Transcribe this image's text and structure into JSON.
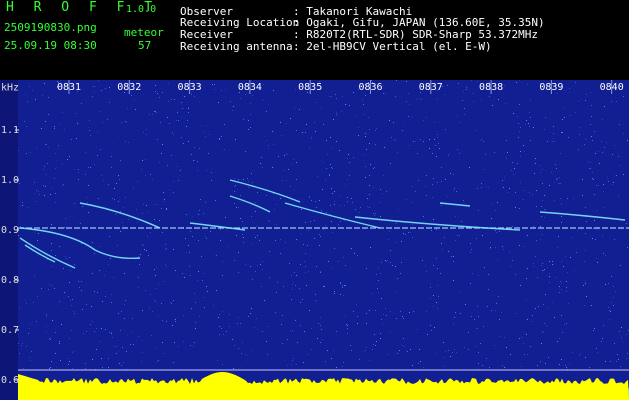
{
  "app": {
    "name": "H R O F F T",
    "version": "1.0.0",
    "filename": "2509190830.png",
    "datetime": "25.09.19 08:30",
    "meteor_label": "meteor",
    "meteor_count": "57"
  },
  "station": {
    "observer_label": "Observer",
    "observer_value": ": Takanori Kawachi",
    "location_label": "Receiving Location",
    "location_value": ": Ogaki, Gifu, JAPAN (136.60E, 35.35N)",
    "receiver_label": "Receiver",
    "receiver_value": ": R820T2(RTL-SDR) SDR-Sharp 53.372MHz",
    "antenna_label": "Receiving antenna",
    "antenna_value": ": 2el-HB9CV Vertical (el. E-W)"
  },
  "spectrogram": {
    "y_unit": "kHz",
    "time_ticks": [
      "0831",
      "0832",
      "0833",
      "0834",
      "0835",
      "0836",
      "0837",
      "0838",
      "0839",
      "0840"
    ],
    "freq_ticks": [
      "1.1",
      "1.0",
      "0.9",
      "0.8",
      "0.7",
      "0.6"
    ],
    "colors": {
      "background": "#101a8a",
      "carrier": "#b8e0ff",
      "meteor": "#7de8ff",
      "level": "#ffff00",
      "level_base": "#00e0ff"
    }
  }
}
